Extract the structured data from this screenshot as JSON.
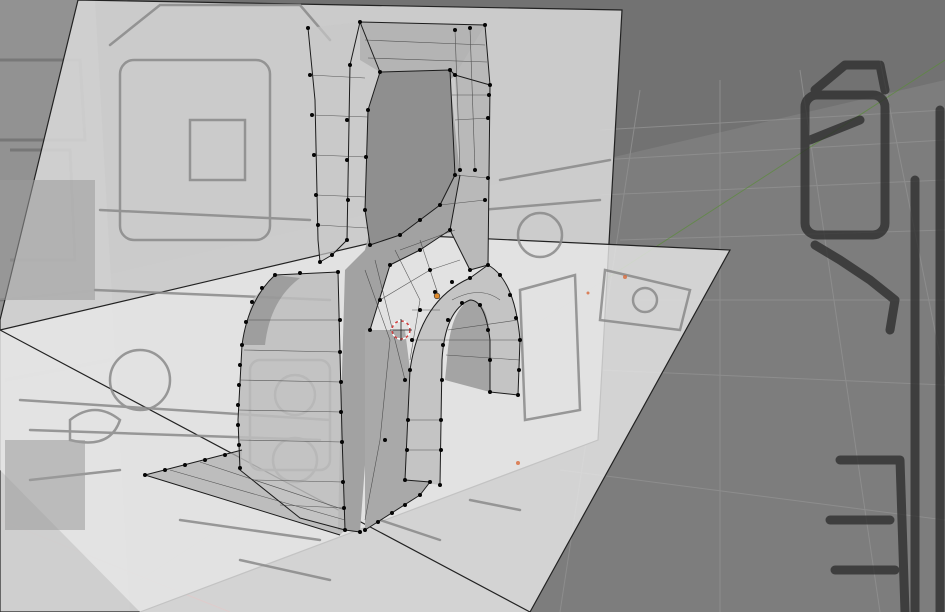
{
  "viewport": {
    "mode": "edit-mode-perspective",
    "colors": {
      "background": "#6f6f6f",
      "floor": "#848484",
      "grid_line": "#919191",
      "reference_plane": "#e2e2e2",
      "reference_sketch": "#8c8c8c",
      "mesh_face": "#a7a7a7",
      "mesh_face_dark": "#8e8e8e",
      "mesh_edge": "#1a1a1a",
      "vertex": "#050505",
      "axis_x": "#c04a4a",
      "axis_y": "#5b8c3a",
      "origin": "#e08a2a",
      "cursor_ring": "#d04040"
    }
  },
  "objects": {
    "reference_images": [
      "side-reference-image",
      "floor-reference-image",
      "back-reference-image"
    ],
    "mesh": "extruded-bracket-mesh",
    "cursor": "3d-cursor"
  }
}
